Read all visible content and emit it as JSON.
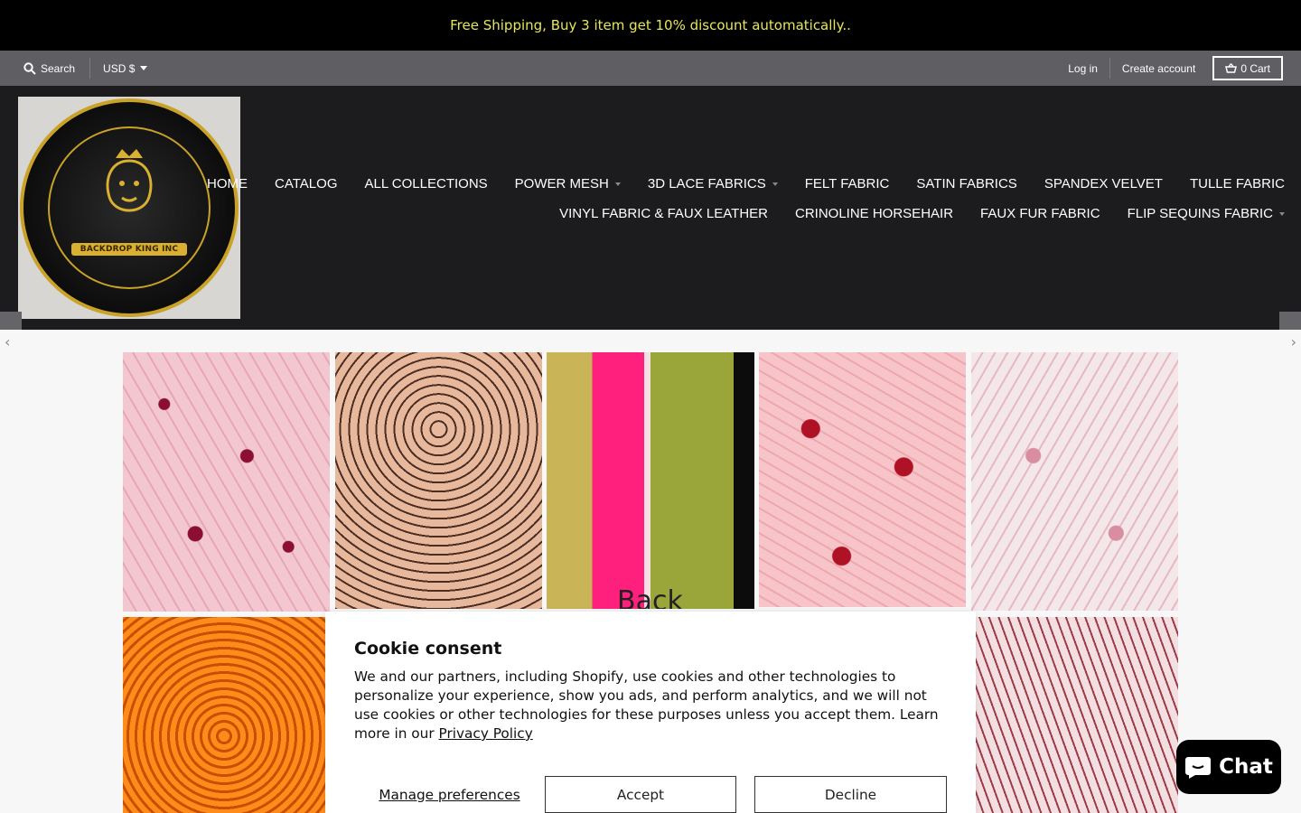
{
  "announcement": "Free Shipping, Buy 3 item get 10% discount automatically..",
  "utility": {
    "search_label": "Search",
    "currency": "USD $",
    "login": "Log in",
    "create_account": "Create account",
    "cart": "0 Cart"
  },
  "logo": {
    "banner_text": "BACKDROP KING INC"
  },
  "nav": {
    "row1": [
      {
        "label": "HOME",
        "dropdown": false
      },
      {
        "label": "CATALOG",
        "dropdown": false
      },
      {
        "label": "ALL COLLECTIONS",
        "dropdown": false
      },
      {
        "label": "POWER MESH",
        "dropdown": true
      },
      {
        "label": "3D LACE FABRICS",
        "dropdown": true
      },
      {
        "label": "FELT FABRIC",
        "dropdown": false
      },
      {
        "label": "SATIN FABRICS",
        "dropdown": false
      },
      {
        "label": "SPANDEX VELVET",
        "dropdown": false
      },
      {
        "label": "TULLE FABRIC",
        "dropdown": false
      }
    ],
    "row2": [
      {
        "label": "VINYL FABRIC & FAUX LEATHER",
        "dropdown": false
      },
      {
        "label": "CRINOLINE HORSEHAIR",
        "dropdown": false
      },
      {
        "label": "FAUX FUR FABRIC",
        "dropdown": false
      },
      {
        "label": "FLIP SEQUINS FABRIC",
        "dropdown": true
      }
    ]
  },
  "gallery": {
    "tile3_text": "Back"
  },
  "cookie": {
    "title": "Cookie consent",
    "body": "We and our partners, including Shopify, use cookies and other technologies to personalize your experience, show you ads, and perform analytics, and we will not use cookies or other technologies for these purposes unless you accept them. Learn more in our ",
    "privacy_link": "Privacy Policy",
    "manage": "Manage preferences",
    "accept": "Accept",
    "decline": "Decline"
  },
  "chat": {
    "label": "Chat"
  },
  "colors": {
    "announcement_text": "#e6e65c",
    "header_bg": "#1c1c1f",
    "utility_bg": "#5e5e63"
  }
}
